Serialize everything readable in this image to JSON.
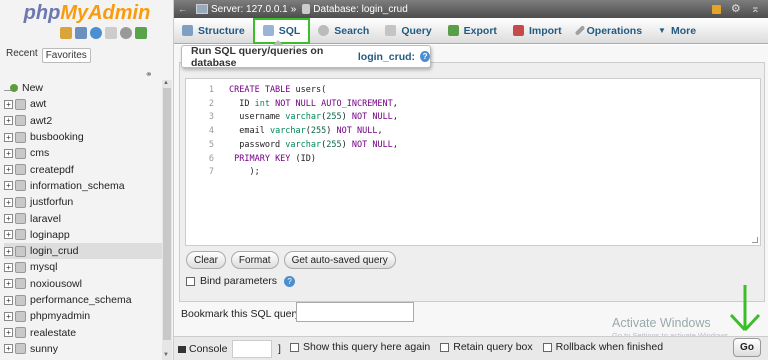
{
  "logo": {
    "part1": "php",
    "part2": "MyAdmin"
  },
  "nav_tabs": {
    "recent": "Recent",
    "favorites": "Favorites"
  },
  "tree": {
    "new": "New",
    "items": [
      "awt",
      "awt2",
      "busbooking",
      "cms",
      "createpdf",
      "information_schema",
      "justforfun",
      "laravel",
      "loginapp",
      "login_crud",
      "mysql",
      "noxiousowl",
      "performance_schema",
      "phpmyadmin",
      "realestate",
      "sunny"
    ],
    "active": "login_crud"
  },
  "breadcrumb": {
    "server": "Server: 127.0.0.1",
    "sep": "»",
    "database": "Database: login_crud"
  },
  "tabs": {
    "structure": "Structure",
    "sql": "SQL",
    "search": "Search",
    "query": "Query",
    "export": "Export",
    "import": "Import",
    "operations": "Operations",
    "more": "More"
  },
  "tooltip": {
    "text": "Run SQL query/queries on database",
    "db": "login_crud:"
  },
  "editor": {
    "lines": [
      {
        "n": "1",
        "parts": [
          [
            "kw",
            "CREATE TABLE "
          ],
          [
            "tx",
            "users("
          ]
        ]
      },
      {
        "n": "2",
        "parts": [
          [
            "tx",
            "  ID "
          ],
          [
            "ty",
            "int "
          ],
          [
            "kw",
            "NOT NULL AUTO_INCREMENT"
          ],
          [
            "tx",
            ","
          ]
        ]
      },
      {
        "n": "3",
        "parts": [
          [
            "tx",
            "  username "
          ],
          [
            "ty",
            "varchar"
          ],
          [
            "tx",
            "("
          ],
          [
            "nm",
            "255"
          ],
          [
            "tx",
            ") "
          ],
          [
            "kw",
            "NOT NULL"
          ],
          [
            "tx",
            ","
          ]
        ]
      },
      {
        "n": "4",
        "parts": [
          [
            "tx",
            "  email "
          ],
          [
            "ty",
            "varchar"
          ],
          [
            "tx",
            "("
          ],
          [
            "nm",
            "255"
          ],
          [
            "tx",
            ") "
          ],
          [
            "kw",
            "NOT NULL"
          ],
          [
            "tx",
            ","
          ]
        ]
      },
      {
        "n": "5",
        "parts": [
          [
            "tx",
            "  password "
          ],
          [
            "ty",
            "varchar"
          ],
          [
            "tx",
            "("
          ],
          [
            "nm",
            "255"
          ],
          [
            "tx",
            ") "
          ],
          [
            "kw",
            "NOT NULL"
          ],
          [
            "tx",
            ","
          ]
        ]
      },
      {
        "n": "6",
        "parts": [
          [
            "tx",
            " "
          ],
          [
            "kw",
            "PRIMARY KEY "
          ],
          [
            "tx",
            "(ID)"
          ]
        ]
      },
      {
        "n": "7",
        "parts": [
          [
            "tx",
            "    );"
          ]
        ]
      }
    ]
  },
  "buttons": {
    "clear": "Clear",
    "format": "Format",
    "auto_saved": "Get auto-saved query"
  },
  "bind_parameters": "Bind parameters",
  "bookmark_label": "Bookmark this SQL query:",
  "console": "Console",
  "bracket": "]",
  "options": {
    "show_query": "Show this query here again",
    "retain_box": "Retain query box",
    "rollback": "Rollback when finished"
  },
  "go": "Go",
  "watermark": {
    "title": "Activate Windows",
    "sub": "Go to Settings to activate Windows."
  },
  "colors": {
    "accent_green": "#3cbd2a",
    "link_blue": "#235a81",
    "keyword": "#770088",
    "type": "#008855"
  }
}
